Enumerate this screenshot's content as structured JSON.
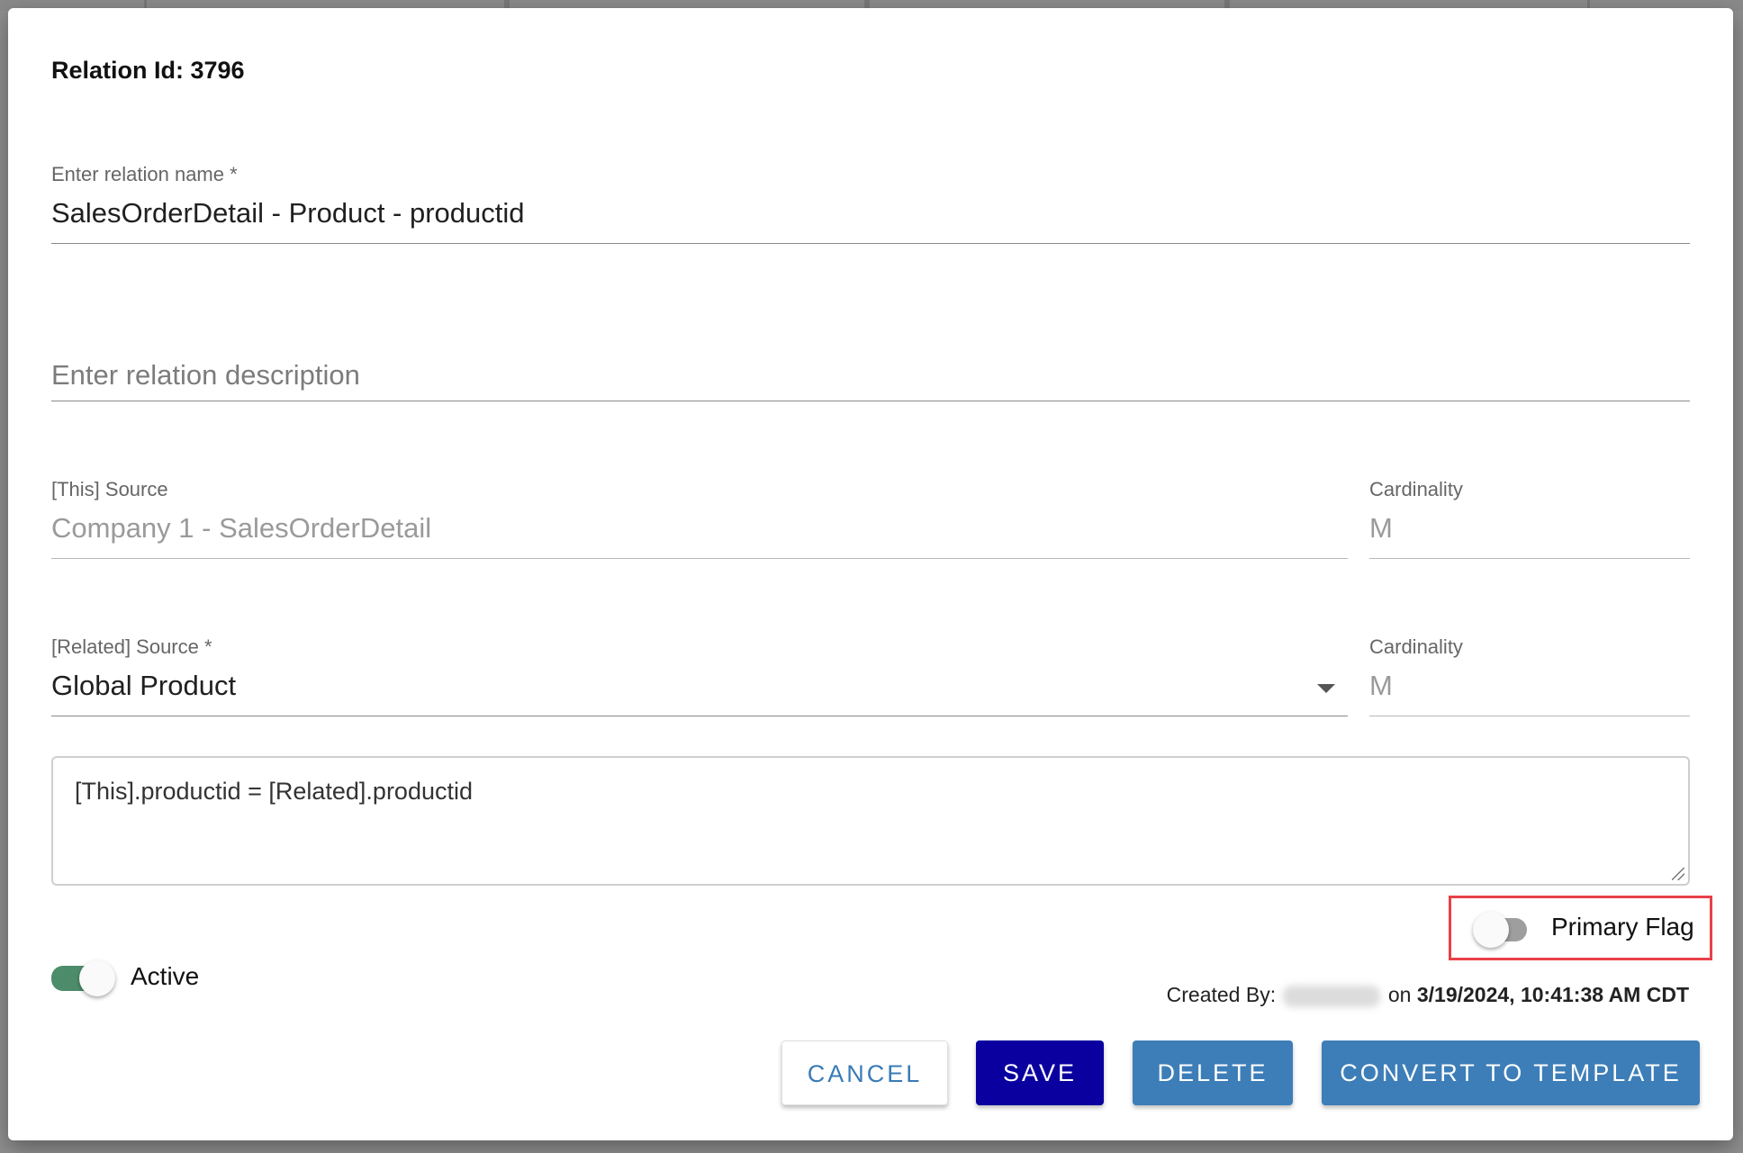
{
  "dialog": {
    "relation_id_label": "Relation Id: 3796",
    "relation_name": {
      "label": "Enter relation name *",
      "value": "SalesOrderDetail - Product - productid"
    },
    "relation_description": {
      "placeholder": "Enter relation description",
      "value": ""
    },
    "this_source": {
      "label": "[This] Source",
      "value": "Company 1 - SalesOrderDetail"
    },
    "this_cardinality": {
      "label": "Cardinality",
      "value": "M"
    },
    "related_source": {
      "label": "[Related] Source *",
      "value": "Global Product"
    },
    "related_cardinality": {
      "label": "Cardinality",
      "value": "M"
    },
    "expression": "[This].productid = [Related].productid",
    "primary_flag": {
      "label": "Primary Flag",
      "on": false
    },
    "active": {
      "label": "Active",
      "on": true
    },
    "created_by": {
      "prefix": "Created By:",
      "between": "on",
      "stamp": "3/19/2024, 10:41:38 AM CDT"
    },
    "buttons": {
      "cancel": "CANCEL",
      "save": "SAVE",
      "delete": "DELETE",
      "convert": "CONVERT TO TEMPLATE"
    }
  },
  "colors": {
    "save_button": "#0a00a0",
    "secondary_button": "#3d7eb8",
    "active_toggle_track": "#4d8c6a",
    "highlight_border": "#e8404a"
  }
}
